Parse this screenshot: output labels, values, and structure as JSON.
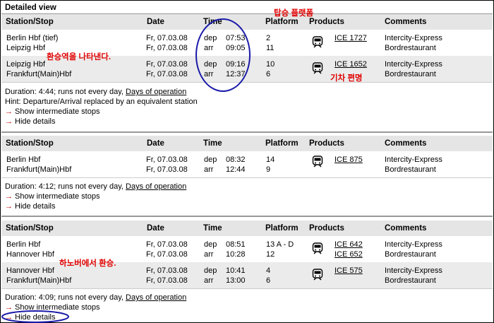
{
  "view_title": "Detailed view",
  "headers": {
    "station": "Station/Stop",
    "date": "Date",
    "time": "Time",
    "platform": "Platform",
    "products": "Products",
    "comments": "Comments"
  },
  "connections": [
    {
      "legs": [
        {
          "from": "Berlin Hbf (tief)",
          "to": "Leipzig Hbf",
          "date1": "Fr, 07.03.08",
          "date2": "Fr, 07.03.08",
          "dep_label": "dep",
          "arr_label": "arr",
          "dep": "07:53",
          "arr": "09:05",
          "plat1": "2",
          "plat2": "11",
          "products": [
            "ICE 1727"
          ],
          "comment1": "Intercity-Express",
          "comment2": "Bordrestaurant"
        },
        {
          "from": "Leipzig Hbf",
          "to": "Frankfurt(Main)Hbf",
          "date1": "Fr, 07.03.08",
          "date2": "Fr, 07.03.08",
          "dep_label": "dep",
          "arr_label": "arr",
          "dep": "09:16",
          "arr": "12:37",
          "plat1": "10",
          "plat2": "6",
          "products": [
            "ICE 1652"
          ],
          "comment1": "Intercity-Express",
          "comment2": "Bordrestaurant"
        }
      ],
      "duration_text": "Duration: 4:44; runs not every day,",
      "days_link": "Days of operation",
      "hint": "Hint: Departure/Arrival replaced by an equivalent station",
      "show_stops": "Show intermediate stops",
      "hide_details": "Hide details"
    },
    {
      "legs": [
        {
          "from": "Berlin Hbf",
          "to": "Frankfurt(Main)Hbf",
          "date1": "Fr, 07.03.08",
          "date2": "Fr, 07.03.08",
          "dep_label": "dep",
          "arr_label": "arr",
          "dep": "08:32",
          "arr": "12:44",
          "plat1": "14",
          "plat2": "9",
          "products": [
            "ICE 875"
          ],
          "comment1": "Intercity-Express",
          "comment2": "Bordrestaurant"
        }
      ],
      "duration_text": "Duration: 4:12; runs not every day,",
      "days_link": "Days of operation",
      "show_stops": "Show intermediate stops",
      "hide_details": "Hide details"
    },
    {
      "legs": [
        {
          "from": "Berlin Hbf",
          "to": "Hannover Hbf",
          "date1": "Fr, 07.03.08",
          "date2": "Fr, 07.03.08",
          "dep_label": "dep",
          "arr_label": "arr",
          "dep": "08:51",
          "arr": "10:28",
          "plat1": "13 A - D",
          "plat2": "12",
          "products": [
            "ICE 642",
            "ICE 652"
          ],
          "comment1": "Intercity-Express",
          "comment2": "Bordrestaurant"
        },
        {
          "from": "Hannover Hbf",
          "to": "Frankfurt(Main)Hbf",
          "date1": "Fr, 07.03.08",
          "date2": "Fr, 07.03.08",
          "dep_label": "dep",
          "arr_label": "arr",
          "dep": "10:41",
          "arr": "13:00",
          "plat1": "4",
          "plat2": "6",
          "products": [
            "ICE 575"
          ],
          "comment1": "Intercity-Express",
          "comment2": "Bordrestaurant"
        }
      ],
      "duration_text": "Duration: 4:09; runs not every day,",
      "days_link": "Days of operation",
      "show_stops": "Show intermediate stops",
      "hide_details": "Hide details"
    }
  ],
  "annotations": {
    "platform_note": "탑승 플랫폼",
    "transfer_station_note": "환승역을 나타낸다.",
    "train_number_note": "기차 편명",
    "hannover_transfer_note": "하노버에서 환승."
  },
  "colors": {
    "annotation": "#e00000",
    "circle": "#1a1aa8",
    "header_bg": "#e5e5e5",
    "row_shade": "#ebebeb",
    "arrow": "#cc0000"
  }
}
